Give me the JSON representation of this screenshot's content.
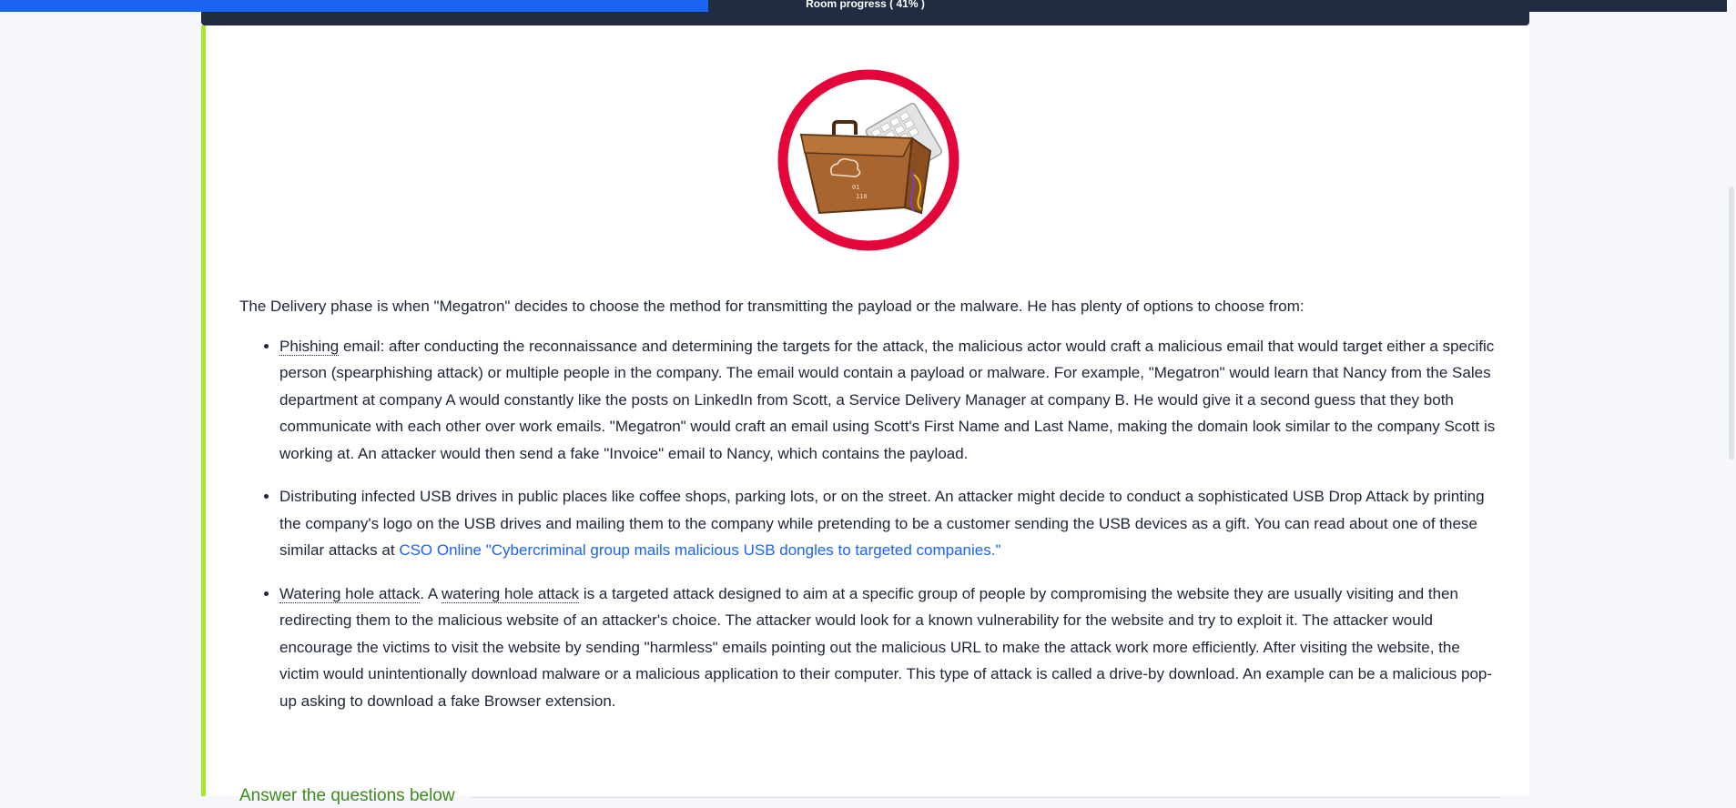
{
  "progress": {
    "label": "Room progress ( 41% )",
    "value": 0.41,
    "fill_color": "#1c63f2",
    "track_color": "#212c42"
  },
  "task": {
    "accent_color": "#a3ea2a",
    "hero_icon": "briefcase-with-keyboard-icon",
    "intro": "The Delivery phase is when \"Megatron\" decides to choose the method for transmitting the payload or the malware. He has plenty of options to choose from:",
    "bullets": [
      {
        "term": "Phishing",
        "text": " email: after conducting the reconnaissance and determining the targets for the attack, the malicious actor would craft a malicious email that would target either a specific person (spearphishing attack) or multiple people in the company. The email would contain a payload or malware. For example, \"Megatron\" would learn that Nancy from the Sales department at company A would constantly like the posts on LinkedIn from Scott, a Service Delivery Manager at company B. He would give it a second guess that they both communicate with each other over work emails. \"Megatron\" would craft an email using Scott's First Name and Last Name, making the domain look similar to the company Scott is working at. An attacker would then send a fake \"Invoice\" email to Nancy, which contains the payload."
      },
      {
        "text": "Distributing infected USB drives in public places like coffee shops, parking lots, or on the street. An attacker might decide to conduct a sophisticated USB Drop Attack by printing the company's logo on the USB drives and mailing them to the company while pretending to be a customer sending the USB devices as a gift. You can read about one of these similar attacks at ",
        "link": "CSO Online \"Cybercriminal group mails malicious USB dongles to targeted companies.\""
      },
      {
        "term": "Watering hole attack",
        "mid": ". A ",
        "term2": "watering hole attack",
        "text": " is a targeted attack designed to aim at a specific group of people by compromising the website they are usually visiting and then redirecting them to the malicious website of an attacker's choice. The attacker would look for a known vulnerability for the website and try to exploit it. The attacker would encourage the victims to visit the website by sending \"harmless\" emails pointing out the malicious URL to make the attack work more efficiently. After visiting the website, the victim would unintentionally download malware or a malicious application to their computer. This type of attack is called a drive-by download. An example can be a malicious pop-up asking to download a fake Browser extension."
      }
    ],
    "answers_title": "Answer the questions below",
    "answers_color": "#3b8c1c",
    "link_color": "#1c63f2"
  }
}
